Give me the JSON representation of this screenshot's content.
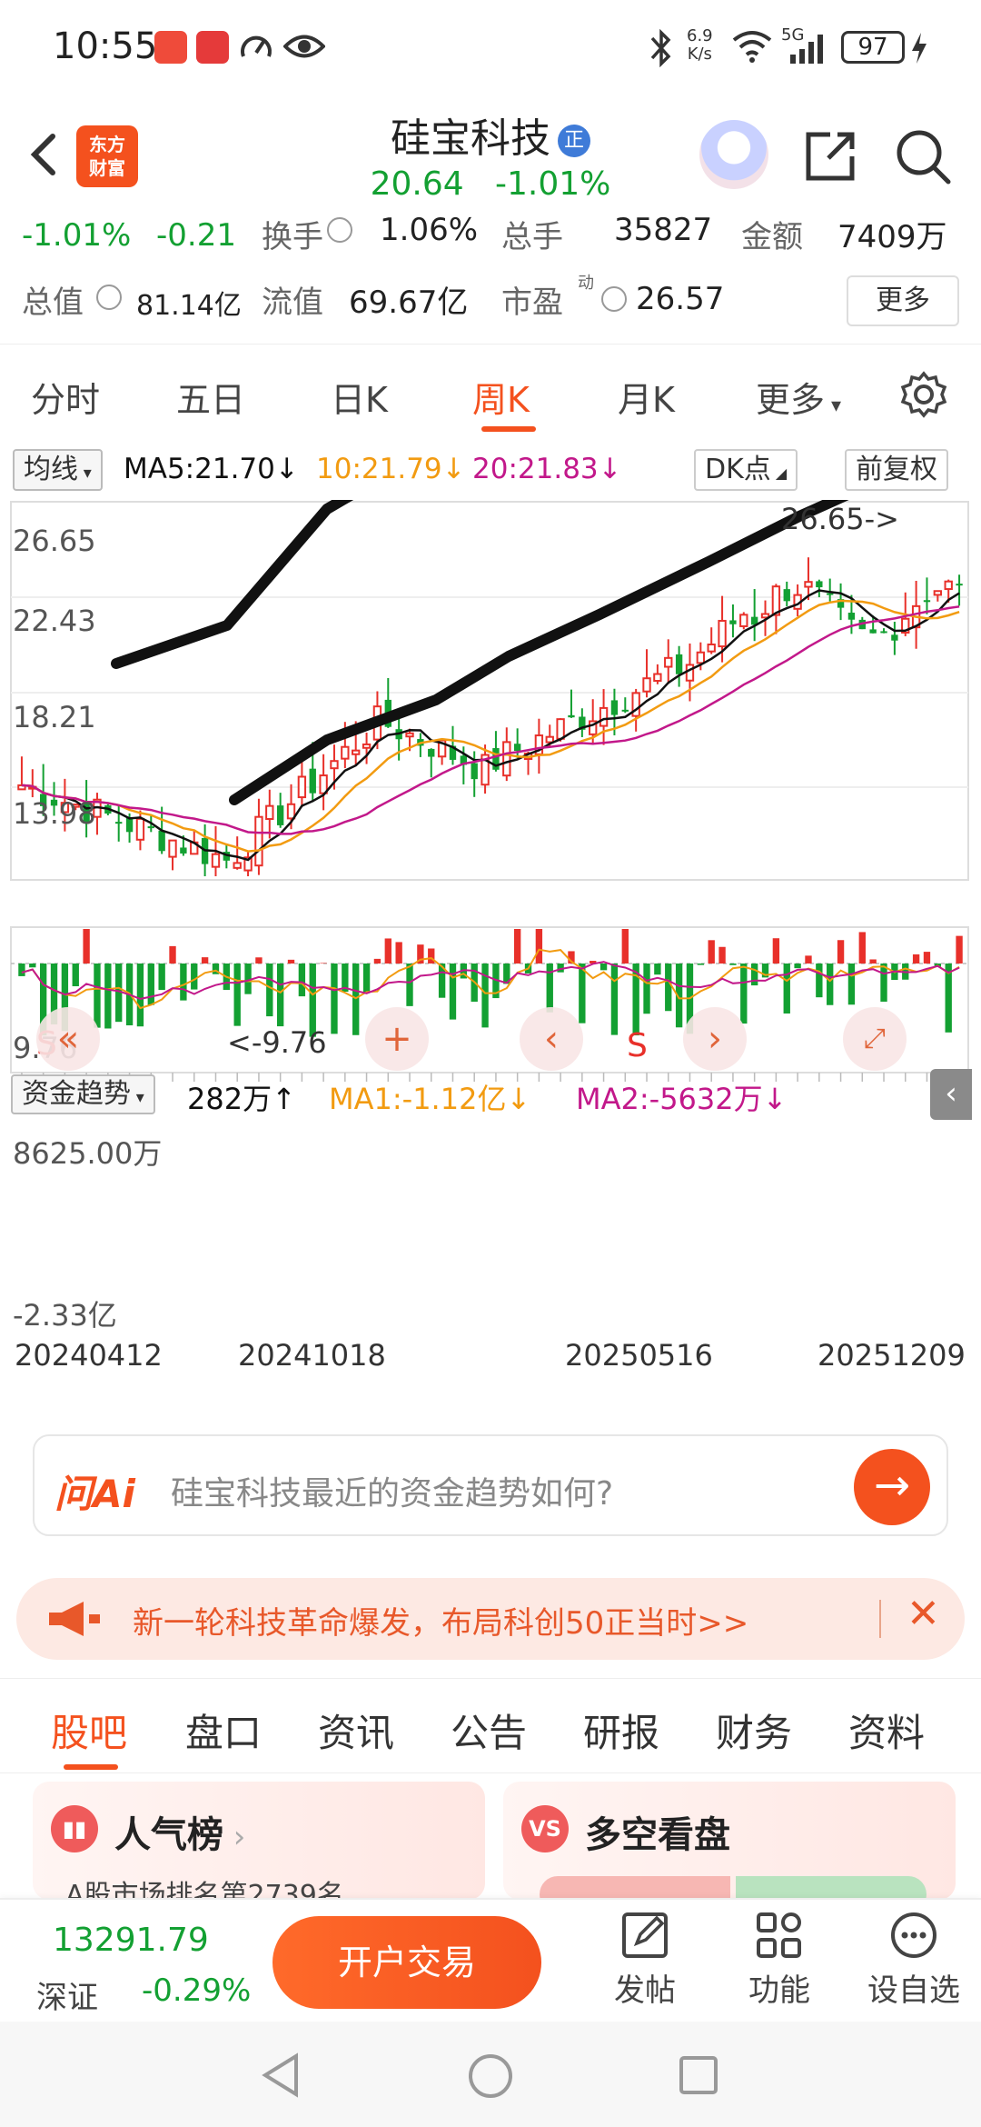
{
  "status_bar": {
    "time": "10:55",
    "net_speed": "6.9\nK/s",
    "network": "5G",
    "battery": "97"
  },
  "header": {
    "brand": "东方\n财富",
    "stock_name": "硅宝科技",
    "badge": "正",
    "price": "20.64",
    "change_pct": "-1.01%"
  },
  "stats": {
    "row1": {
      "change_pct": "-1.01%",
      "change_amt": "-0.21",
      "turnover_label": "换手",
      "turnover_value": "1.06%",
      "volume_label": "总手",
      "volume_value": "35827",
      "amount_label": "金额",
      "amount_value": "7409万"
    },
    "row2": {
      "mcap_label": "总值",
      "mcap_value": "81.14亿",
      "float_label": "流值",
      "float_value": "69.67亿",
      "pe_label": "市盈",
      "pe_sup": "动",
      "pe_value": "26.57",
      "more": "更多"
    }
  },
  "k_tabs": {
    "items": [
      "分时",
      "五日",
      "日K",
      "周K",
      "月K",
      "更多"
    ],
    "active": "周K"
  },
  "ma_bar": {
    "selector": "均线",
    "ma5": "MA5:21.70↓",
    "ma10": "10:21.79↓",
    "ma20": "20:21.83↓",
    "dk": "DK点",
    "adjust": "前复权"
  },
  "chart_data": {
    "type": "candlestick",
    "y_ticks": [
      "26.65",
      "22.43",
      "18.21",
      "13.98",
      "9.76"
    ],
    "ylim": [
      9.76,
      26.65
    ],
    "high_label": "26.65->",
    "low_label": "<-9.76",
    "marker_s": "S",
    "fund_flow": {
      "label": "资金趋势",
      "value": "282万↑",
      "ma1": "MA1:-1.12亿↓",
      "ma2": "MA2:-5632万↓",
      "y_top": "8625.00万",
      "y_bottom": "-2.33亿"
    },
    "x_labels": [
      "20240412",
      "20241018",
      "20250516",
      "20251209"
    ],
    "colors": {
      "up": "#e8302a",
      "down": "#13a032",
      "ma5": "#111111",
      "ma10": "#f29b11",
      "ma20": "#c2188a"
    }
  },
  "ask_ai": {
    "logo": "问Ai",
    "placeholder": "硅宝科技最近的资金趋势如何?"
  },
  "banner": {
    "text": "新一轮科技革命爆发，布局科创50正当时>>"
  },
  "section_tabs": {
    "items": [
      "股吧",
      "盘口",
      "资讯",
      "公告",
      "研报",
      "财务",
      "资料"
    ],
    "active": "股吧"
  },
  "cards": {
    "popularity_title": "人气榜",
    "popularity_sub": "A股市场排名第2739名",
    "longshort_title": "多空看盘",
    "longshort_badge": "VS"
  },
  "bottom_bar": {
    "index_value": "13291.79",
    "market": "深证",
    "market_change": "-0.29%",
    "trade": "开户交易",
    "post": "发帖",
    "functions": "功能",
    "watchlist": "设自选"
  }
}
